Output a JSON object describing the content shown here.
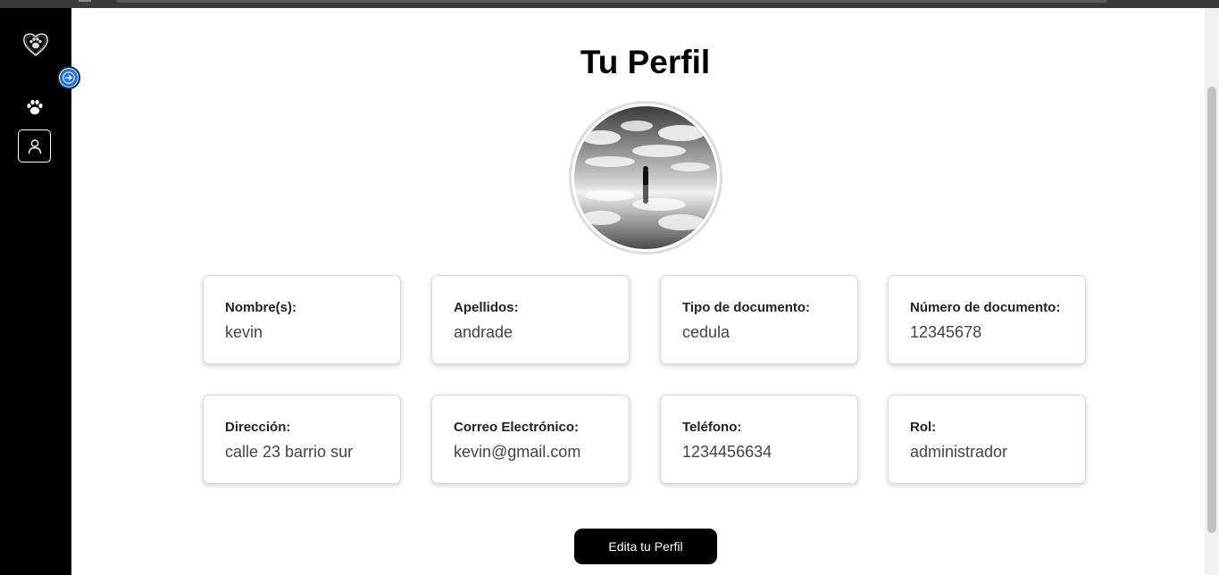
{
  "page": {
    "title": "Tu Perfil"
  },
  "sidebar": {
    "items": [
      {
        "icon": "paw-icon"
      },
      {
        "icon": "user-icon"
      }
    ],
    "expand_icon": "arrow-right-icon",
    "logo_icon": "paw-heart-logo-icon"
  },
  "profile": {
    "fields": [
      {
        "label": "Nombre(s):",
        "value": "kevin"
      },
      {
        "label": "Apellidos:",
        "value": "andrade"
      },
      {
        "label": "Tipo de documento:",
        "value": "cedula"
      },
      {
        "label": "Número de documento:",
        "value": "12345678"
      },
      {
        "label": "Dirección:",
        "value": "calle 23 barrio sur"
      },
      {
        "label": "Correo Electrónico:",
        "value": "kevin@gmail.com"
      },
      {
        "label": "Teléfono:",
        "value": "1234456634"
      },
      {
        "label": "Rol:",
        "value": "administrador"
      }
    ]
  },
  "actions": {
    "edit_label": "Edita tu Perfil"
  },
  "colors": {
    "sidebar_bg": "#000000",
    "accent": "#1a73e8",
    "button_bg": "#000000"
  }
}
